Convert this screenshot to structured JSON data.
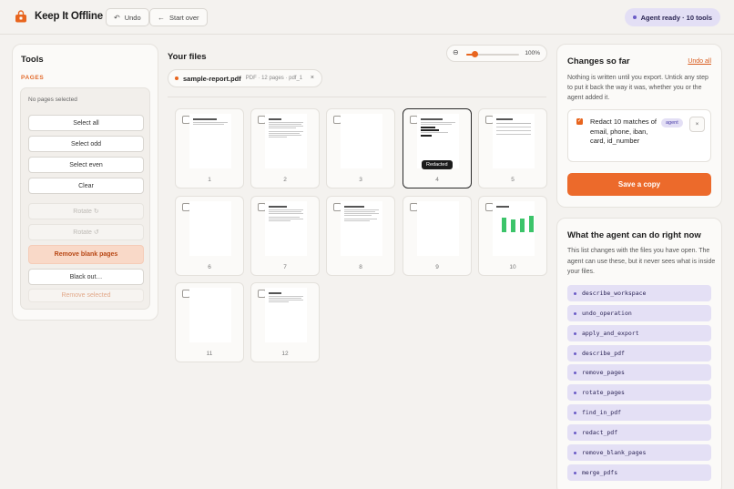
{
  "header": {
    "brand": "Keep It Offline",
    "undo_label": "Undo",
    "start_over_label": "Start over",
    "agent_status": "Agent ready · 10 tools"
  },
  "tools": {
    "title": "Tools",
    "section": "PAGES",
    "selection_status": "No pages selected",
    "buttons": [
      "Select all",
      "Select odd",
      "Select even",
      "Clear",
      "Rotate ↻",
      "Rotate ↺",
      "Remove blank pages",
      "Black out…",
      "Remove selected"
    ]
  },
  "files": {
    "title": "Your files",
    "zoom_label": "100%",
    "zoom_level": 0.15,
    "file_name": "sample-report.pdf",
    "file_meta": "PDF · 12 pages · pdf_1",
    "close_glyph": "×"
  },
  "pages": [
    {
      "num": "1",
      "badge": ""
    },
    {
      "num": "2",
      "badge": ""
    },
    {
      "num": "3",
      "badge": ""
    },
    {
      "num": "4",
      "badge": "Redacted"
    },
    {
      "num": "5",
      "badge": ""
    },
    {
      "num": "6",
      "badge": ""
    },
    {
      "num": "7",
      "badge": ""
    },
    {
      "num": "8",
      "badge": ""
    },
    {
      "num": "9",
      "badge": ""
    },
    {
      "num": "10",
      "badge": ""
    },
    {
      "num": "11",
      "badge": ""
    },
    {
      "num": "12",
      "badge": ""
    }
  ],
  "changes": {
    "title": "Changes so far",
    "undo_all": "Undo all",
    "description": "Nothing is written until you export. Untick any step to put it back the way it was, whether you or the agent added it.",
    "items": [
      {
        "text": "Redact 10 matches of email, phone, iban, card, id_number",
        "tag": "agent",
        "checked": true,
        "remove_glyph": "×"
      }
    ],
    "save_label": "Save a copy"
  },
  "agent_panel": {
    "title": "What the agent can do right now",
    "description": "This list changes with the files you have open. The agent can use these, but it never sees what is inside your files.",
    "tools": [
      "describe_workspace",
      "undo_operation",
      "apply_and_export",
      "describe_pdf",
      "remove_pages",
      "rotate_pages",
      "find_in_pdf",
      "redact_pdf",
      "remove_blank_pages",
      "merge_pdfs"
    ]
  },
  "colors": {
    "accent": "#ec6a2b",
    "agent": "#6b5cc7",
    "chart_green": "#3cc46a"
  }
}
